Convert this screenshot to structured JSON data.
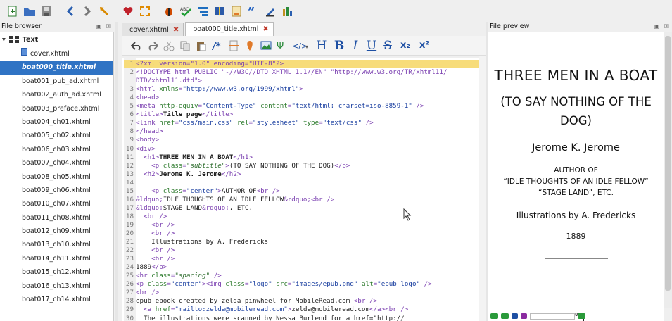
{
  "file_browser": {
    "title": "File browser",
    "panel_controls": "▣ ☒",
    "group": "Text",
    "items": [
      "cover.xhtml",
      "boat000_title.xhtml",
      "boat001_pub_ad.xhtml",
      "boat002_auth_ad.xhtml",
      "boat003_preface.xhtml",
      "boat004_ch01.xhtml",
      "boat005_ch02.xhtml",
      "boat006_ch03.xhtml",
      "boat007_ch04.xhtml",
      "boat008_ch05.xhtml",
      "boat009_ch06.xhtml",
      "boat010_ch07.xhtml",
      "boat011_ch08.xhtml",
      "boat012_ch09.xhtml",
      "boat013_ch10.xhtml",
      "boat014_ch11.xhtml",
      "boat015_ch12.xhtml",
      "boat016_ch13.xhtml",
      "boat017_ch14.xhtml"
    ],
    "selected_index": 1
  },
  "tabs": [
    {
      "label": "cover.xhtml",
      "active": false
    },
    {
      "label": "boat000_title.xhtml",
      "active": true
    }
  ],
  "format_buttons": {
    "heading": "H",
    "bold": "B",
    "italic": "I",
    "underline": "U",
    "strike": "S",
    "subscript": "x₂",
    "superscript": "x²"
  },
  "code": {
    "current_line": 1,
    "lines": [
      {
        "n": "1",
        "segs": [
          [
            "pi",
            "<?xml version=\"1.0\" encoding=\"UTF-8\"?>"
          ]
        ]
      },
      {
        "n": "2",
        "segs": [
          [
            "tag",
            "<!DOCTYPE html PUBLIC \"-//W3C//DTD XHTML 1.1//EN\" \"http://www.w3.org/TR/xhtml11/"
          ]
        ]
      },
      {
        "n": "",
        "segs": [
          [
            "tag",
            "DTD/xhtml11.dtd\">"
          ]
        ]
      },
      {
        "n": "3",
        "segs": [
          [
            "tag",
            "<html "
          ],
          [
            "attr",
            "xmlns"
          ],
          [
            "tag",
            "="
          ],
          [
            "str",
            "\"http://www.w3.org/1999/xhtml\""
          ],
          [
            "tag",
            ">"
          ]
        ]
      },
      {
        "n": "4",
        "segs": [
          [
            "tag",
            "<head>"
          ]
        ]
      },
      {
        "n": "5",
        "segs": [
          [
            "tag",
            "<meta "
          ],
          [
            "attr",
            "http-equiv"
          ],
          [
            "tag",
            "="
          ],
          [
            "str",
            "\"Content-Type\""
          ],
          [
            "tag",
            " "
          ],
          [
            "attr",
            "content"
          ],
          [
            "tag",
            "="
          ],
          [
            "str",
            "\"text/html; charset=iso-8859-1\""
          ],
          [
            "tag",
            " />"
          ]
        ]
      },
      {
        "n": "6",
        "segs": [
          [
            "tag",
            "<title>"
          ],
          [
            "b",
            "Title page"
          ],
          [
            "tag",
            "</title>"
          ]
        ]
      },
      {
        "n": "7",
        "segs": [
          [
            "tag",
            "<link "
          ],
          [
            "attr",
            "href"
          ],
          [
            "tag",
            "="
          ],
          [
            "str",
            "\"css/main.css\""
          ],
          [
            "tag",
            " "
          ],
          [
            "attr",
            "rel"
          ],
          [
            "tag",
            "="
          ],
          [
            "str",
            "\"stylesheet\""
          ],
          [
            "tag",
            " "
          ],
          [
            "attr",
            "type"
          ],
          [
            "tag",
            "="
          ],
          [
            "str",
            "\"text/css\""
          ],
          [
            "tag",
            " />"
          ]
        ]
      },
      {
        "n": "8",
        "segs": [
          [
            "tag",
            "</head>"
          ]
        ]
      },
      {
        "n": "9",
        "segs": [
          [
            "tag",
            "<body>"
          ]
        ]
      },
      {
        "n": "10",
        "segs": [
          [
            "tag",
            "<div>"
          ]
        ]
      },
      {
        "n": "11",
        "segs": [
          [
            "txt",
            "  "
          ],
          [
            "tag",
            "<h1>"
          ],
          [
            "b",
            "THREE MEN IN A BOAT"
          ],
          [
            "tag",
            "</h1>"
          ]
        ]
      },
      {
        "n": "12",
        "segs": [
          [
            "txt",
            "    "
          ],
          [
            "tag",
            "<p "
          ],
          [
            "attr",
            "class"
          ],
          [
            "tag",
            "="
          ],
          [
            "em",
            "\"subtitle\""
          ],
          [
            "tag",
            ">"
          ],
          [
            "txt",
            "(TO SAY NOTHING OF THE DOG)"
          ],
          [
            "tag",
            "</p>"
          ]
        ]
      },
      {
        "n": "13",
        "segs": [
          [
            "txt",
            "  "
          ],
          [
            "tag",
            "<h2>"
          ],
          [
            "b",
            "Jerome K. Jerome"
          ],
          [
            "tag",
            "</h2>"
          ]
        ]
      },
      {
        "n": "14",
        "segs": [
          [
            "txt",
            ""
          ]
        ]
      },
      {
        "n": "15",
        "segs": [
          [
            "txt",
            "    "
          ],
          [
            "tag",
            "<p "
          ],
          [
            "attr",
            "class"
          ],
          [
            "tag",
            "="
          ],
          [
            "str",
            "\"center\""
          ],
          [
            "tag",
            ">"
          ],
          [
            "txt",
            "AUTHOR OF"
          ],
          [
            "tag",
            "<br />"
          ]
        ]
      },
      {
        "n": "16",
        "segs": [
          [
            "ent",
            "&ldquo;"
          ],
          [
            "txt",
            "IDLE THOUGHTS OF AN IDLE FELLOW"
          ],
          [
            "ent",
            "&rdquo;"
          ],
          [
            "tag",
            "<br />"
          ]
        ]
      },
      {
        "n": "17",
        "segs": [
          [
            "ent",
            "&ldquo;"
          ],
          [
            "txt",
            "STAGE LAND"
          ],
          [
            "ent",
            "&rdquo;"
          ],
          [
            "txt",
            ", ETC."
          ]
        ]
      },
      {
        "n": "18",
        "segs": [
          [
            "txt",
            "  "
          ],
          [
            "tag",
            "<br />"
          ]
        ]
      },
      {
        "n": "19",
        "segs": [
          [
            "txt",
            "    "
          ],
          [
            "tag",
            "<br />"
          ]
        ]
      },
      {
        "n": "20",
        "segs": [
          [
            "txt",
            "    "
          ],
          [
            "tag",
            "<br />"
          ]
        ]
      },
      {
        "n": "21",
        "segs": [
          [
            "txt",
            "    Illustrations by A. Fredericks"
          ]
        ]
      },
      {
        "n": "22",
        "segs": [
          [
            "txt",
            "    "
          ],
          [
            "tag",
            "<br />"
          ]
        ]
      },
      {
        "n": "23",
        "segs": [
          [
            "txt",
            "    "
          ],
          [
            "tag",
            "<br />"
          ]
        ]
      },
      {
        "n": "24",
        "segs": [
          [
            "txt",
            "1889"
          ],
          [
            "tag",
            "</p>"
          ]
        ]
      },
      {
        "n": "25",
        "segs": [
          [
            "tag",
            "<hr "
          ],
          [
            "attr",
            "class"
          ],
          [
            "tag",
            "="
          ],
          [
            "em",
            "\"spacing\""
          ],
          [
            "tag",
            " />"
          ]
        ]
      },
      {
        "n": "26",
        "segs": [
          [
            "tag",
            "<p "
          ],
          [
            "attr",
            "class"
          ],
          [
            "tag",
            "="
          ],
          [
            "str",
            "\"center\""
          ],
          [
            "tag",
            "><img "
          ],
          [
            "attr",
            "class"
          ],
          [
            "tag",
            "="
          ],
          [
            "str",
            "\"logo\""
          ],
          [
            "tag",
            " "
          ],
          [
            "attr",
            "src"
          ],
          [
            "tag",
            "="
          ],
          [
            "str",
            "\"images/epub.png\""
          ],
          [
            "tag",
            " "
          ],
          [
            "attr",
            "alt"
          ],
          [
            "tag",
            "="
          ],
          [
            "str",
            "\"epub logo\""
          ],
          [
            "tag",
            " />"
          ]
        ]
      },
      {
        "n": "27",
        "segs": [
          [
            "tag",
            "<br />"
          ]
        ]
      },
      {
        "n": "28",
        "segs": [
          [
            "txt",
            "epub ebook created by zelda pinwheel for MobileRead.com "
          ],
          [
            "tag",
            "<br />"
          ]
        ]
      },
      {
        "n": "29",
        "segs": [
          [
            "txt",
            "  "
          ],
          [
            "tag",
            "<a "
          ],
          [
            "attr",
            "href"
          ],
          [
            "tag",
            "="
          ],
          [
            "str",
            "\"mailto:zelda@mobileread.com\""
          ],
          [
            "tag",
            ">"
          ],
          [
            "txt",
            "zelda@mobileread.com"
          ],
          [
            "tag",
            "</a><br />"
          ]
        ]
      },
      {
        "n": "30",
        "segs": [
          [
            "txt",
            "  The illustrations were scanned by Nessa Burlend for a href=\"http://"
          ]
        ]
      }
    ]
  },
  "preview": {
    "title": "File preview",
    "panel_controls": "▣ ☒",
    "h1": "THREE MEN IN A BOAT",
    "subtitle": "(TO SAY NOTHING OF THE DOG)",
    "author": "Jerome K. Jerome",
    "author_of": "AUTHOR OF",
    "idle": "“IDLE THOUGHTS OF AN IDLE FELLOW”",
    "stage": "“STAGE LAND”, ETC.",
    "illustrations": "Illustrations by A. Fredericks",
    "year": "1889",
    "logo_text": "▯ PUB"
  },
  "colors": {
    "selected_row": "#2f73c4",
    "current_line": "#f7dc7a",
    "tag": "#7a3fb0",
    "attr": "#2c7a2c",
    "string": "#1a3fa0",
    "format_blue": "#1d4fa3"
  }
}
